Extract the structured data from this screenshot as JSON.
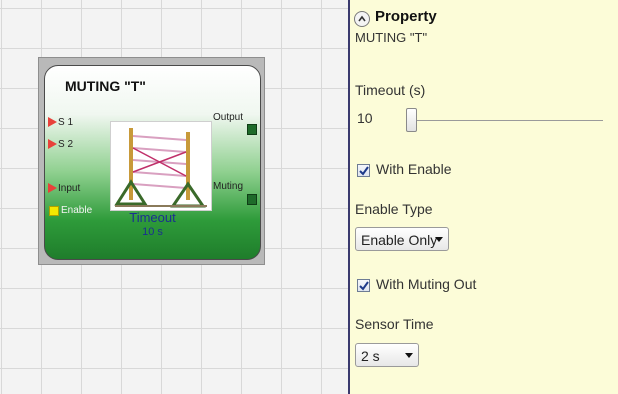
{
  "block": {
    "title": "MUTING \"T\"",
    "inputs": [
      "S 1",
      "S 2",
      "Input",
      "Enable"
    ],
    "outputs": [
      "Output",
      "Muting"
    ],
    "param_label": "Timeout",
    "param_value": "10 s",
    "image_icon": "muting-light-curtain-image"
  },
  "property": {
    "title": "Property",
    "subtitle": "MUTING \"T\"",
    "timeout_label": "Timeout (s)",
    "timeout_value": "10",
    "with_enable_label": "With Enable",
    "with_enable_checked": true,
    "enable_type_label": "Enable Type",
    "enable_type_value": "Enable Only",
    "with_muting_out_label": "With Muting Out",
    "with_muting_out_checked": true,
    "sensor_time_label": "Sensor Time",
    "sensor_time_value": "2 s"
  },
  "colors": {
    "panel_bg": "#fcfcd8",
    "block_green": "#2e9b3a",
    "param_text": "#1b2f8f",
    "input_pin": "#e8413a",
    "enable_pin": "#f4e800"
  }
}
